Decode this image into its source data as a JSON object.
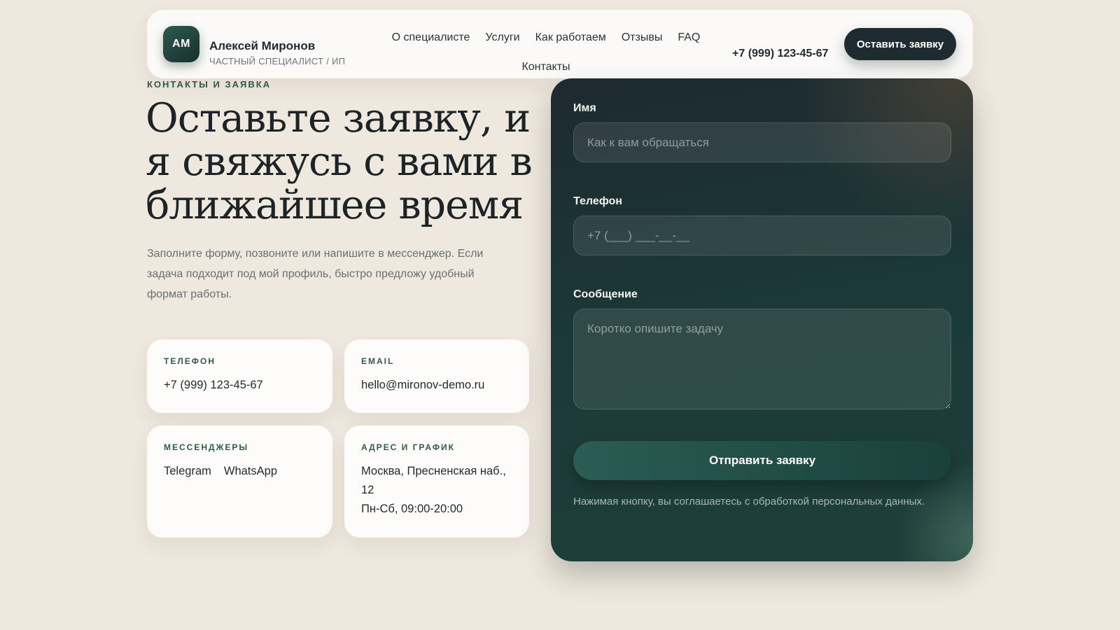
{
  "header": {
    "logo_initials": "АМ",
    "brand_name": "Алексей Миронов",
    "brand_subtitle": "ЧАСТНЫЙ СПЕЦИАЛИСТ / ИП",
    "nav": [
      {
        "label": "О специалисте"
      },
      {
        "label": "Услуги"
      },
      {
        "label": "Как работаем"
      },
      {
        "label": "Отзывы"
      },
      {
        "label": "FAQ"
      },
      {
        "label": "Контакты"
      }
    ],
    "phone": "+7 (999) 123-45-67",
    "cta_label": "Оставить заявку"
  },
  "hero": {
    "eyebrow": "КОНТАКТЫ И ЗАЯВКА",
    "headline": "Оставьте заявку, и я свяжусь с вами в ближайшее время",
    "lead": "Заполните форму, позвоните или напишите в мессенджер. Если задача подходит под мой профиль, быстро предложу удобный формат работы."
  },
  "contacts": {
    "phone": {
      "label": "ТЕЛЕФОН",
      "value": "+7 (999) 123-45-67"
    },
    "email": {
      "label": "EMAIL",
      "value": "hello@mironov-demo.ru"
    },
    "messengers": {
      "label": "МЕССЕНДЖЕРЫ",
      "items": [
        "Telegram",
        "WhatsApp"
      ]
    },
    "address": {
      "label": "АДРЕС И ГРАФИК",
      "address": "Москва, Пресненская наб., 12",
      "hours": "Пн-Сб, 09:00-20:00"
    }
  },
  "form": {
    "name_label": "Имя",
    "name_placeholder": "Как к вам обращаться",
    "phone_label": "Телефон",
    "phone_placeholder": "+7 (___) ___-__-__",
    "message_label": "Сообщение",
    "message_placeholder": "Коротко опишите задачу",
    "submit_label": "Отправить заявку",
    "consent": "Нажимая кнопку, вы соглашаетесь с обработкой персональных данных."
  },
  "colors": {
    "background": "#efe8de",
    "accent_green": "#2f5a50",
    "dark": "#1e2c31"
  }
}
